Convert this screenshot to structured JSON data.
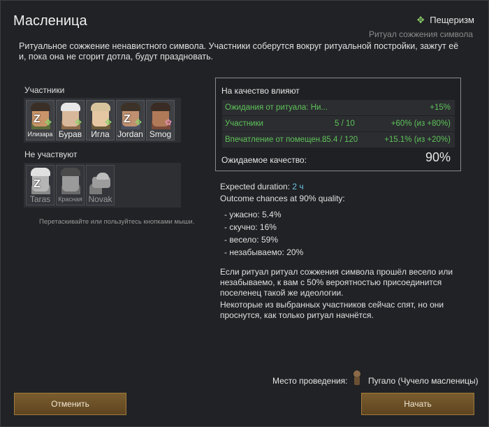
{
  "dialog": {
    "title": "Масленица",
    "ideology": "Пещеризм",
    "ritual_name": "Ритуал сожжения символа",
    "description": "Ритуальное сожжение ненавистного символа. Участники соберутся вокруг ритуальной постройки, зажгут её и, пока она не сгорит дотла, будут праздновать."
  },
  "participants": {
    "label": "Участники",
    "pawns": [
      {
        "name": "Илизара",
        "sleeping": true,
        "skin": "#c9946a",
        "hat": "#3a2f27",
        "body": "#5b6b3a"
      },
      {
        "name": "Бурав",
        "sleeping": false,
        "skin": "#d8b89a",
        "hat": "#e8e8e8",
        "body": "#8a6a4a"
      },
      {
        "name": "Игла",
        "sleeping": false,
        "skin": "#e6c7a3",
        "hat": "#d8c49c",
        "body": "#6b5a3a"
      },
      {
        "name": "Jordan",
        "sleeping": true,
        "skin": "#c09070",
        "hat": "#3d3228",
        "body": "#4a5060"
      },
      {
        "name": "Smog",
        "sleeping": false,
        "skin": "#b07a58",
        "hat": "#3a2c24",
        "body": "#7a4a3a"
      }
    ]
  },
  "non_participants": {
    "label": "Не участвуют",
    "pawns": [
      {
        "name": "Taras"
      },
      {
        "name": "Красная"
      },
      {
        "name": "Novak"
      }
    ]
  },
  "drag_hint": "Перетаскивайте или пользуйтесь кнопками мыши.",
  "quality": {
    "title": "На качество влияют",
    "rows": [
      {
        "name": "Ожидания от ритуала: Ни...",
        "value": "",
        "effect": "+15%"
      },
      {
        "name": "Участники",
        "value": "5 / 10",
        "effect": "+60% (из +80%)"
      },
      {
        "name": "Впечатление от помещен...",
        "value": "85.4 / 120",
        "effect": "+15.1% (из +20%)"
      }
    ],
    "expected_label": "Ожидаемое качество:",
    "expected_value": "90%"
  },
  "duration": {
    "label": "Expected duration:",
    "value": "2 ч"
  },
  "outcome": {
    "label": "Outcome chances at 90% quality:",
    "items": [
      "- ужасно: 5.4%",
      "- скучно: 16%",
      "- весело: 59%",
      "- незабываемо: 20%"
    ]
  },
  "notes": [
    "Если ритуал ритуал сожжения символа прошёл весело или незабываемо, к вам с 50% вероятностью присоединится поселенец такой же идеологии.",
    "Некоторые из выбранных участников сейчас спят, но они проснутся, как только ритуал начнётся."
  ],
  "venue": {
    "label": "Место проведения:",
    "name": "Пугало (Чучело масленицы)"
  },
  "buttons": {
    "cancel": "Отменить",
    "start": "Начать"
  }
}
